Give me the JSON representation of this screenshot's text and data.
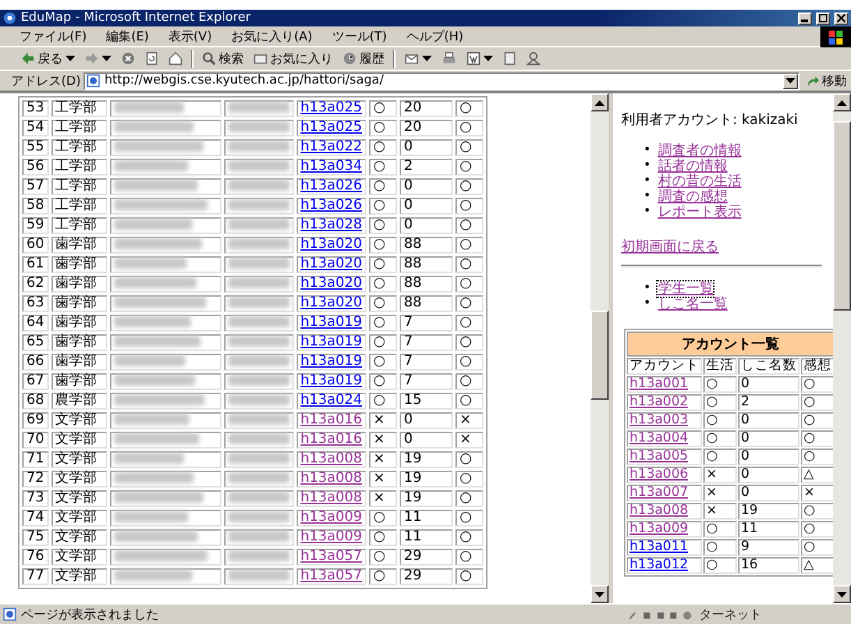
{
  "window": {
    "title": "EduMap - Microsoft Internet Explorer"
  },
  "menu": [
    "ファイル(F)",
    "編集(E)",
    "表示(V)",
    "お気に入り(A)",
    "ツール(T)",
    "ヘルプ(H)"
  ],
  "toolbar": [
    {
      "kind": "back",
      "label": "戻る"
    },
    {
      "kind": "forward"
    },
    {
      "kind": "stop"
    },
    {
      "kind": "refresh"
    },
    {
      "kind": "home"
    },
    {
      "kind": "search",
      "label": "検索"
    },
    {
      "kind": "favorites",
      "label": "お気に入り"
    },
    {
      "kind": "history",
      "label": "履歴"
    },
    {
      "kind": "mail"
    },
    {
      "kind": "print"
    },
    {
      "kind": "edit"
    },
    {
      "kind": "discuss"
    },
    {
      "kind": "messenger"
    }
  ],
  "address": {
    "label": "アドレス(D)",
    "value": "http://webgis.cse.kyutech.ac.jp/hattori/saga/",
    "go": "移動"
  },
  "student_rows": [
    {
      "no": "53",
      "faculty": "工学部",
      "account": "h13a025",
      "visited": false,
      "life": "○",
      "count": "20",
      "impression": "○"
    },
    {
      "no": "54",
      "faculty": "工学部",
      "account": "h13a025",
      "visited": false,
      "life": "○",
      "count": "20",
      "impression": "○"
    },
    {
      "no": "55",
      "faculty": "工学部",
      "account": "h13a022",
      "visited": false,
      "life": "○",
      "count": "0",
      "impression": "○"
    },
    {
      "no": "56",
      "faculty": "工学部",
      "account": "h13a034",
      "visited": false,
      "life": "○",
      "count": "2",
      "impression": "○"
    },
    {
      "no": "57",
      "faculty": "工学部",
      "account": "h13a026",
      "visited": false,
      "life": "○",
      "count": "0",
      "impression": "○"
    },
    {
      "no": "58",
      "faculty": "工学部",
      "account": "h13a026",
      "visited": false,
      "life": "○",
      "count": "0",
      "impression": "○"
    },
    {
      "no": "59",
      "faculty": "工学部",
      "account": "h13a028",
      "visited": false,
      "life": "○",
      "count": "0",
      "impression": "○"
    },
    {
      "no": "60",
      "faculty": "歯学部",
      "account": "h13a020",
      "visited": false,
      "life": "○",
      "count": "88",
      "impression": "○"
    },
    {
      "no": "61",
      "faculty": "歯学部",
      "account": "h13a020",
      "visited": false,
      "life": "○",
      "count": "88",
      "impression": "○"
    },
    {
      "no": "62",
      "faculty": "歯学部",
      "account": "h13a020",
      "visited": false,
      "life": "○",
      "count": "88",
      "impression": "○"
    },
    {
      "no": "63",
      "faculty": "歯学部",
      "account": "h13a020",
      "visited": false,
      "life": "○",
      "count": "88",
      "impression": "○"
    },
    {
      "no": "64",
      "faculty": "歯学部",
      "account": "h13a019",
      "visited": false,
      "life": "○",
      "count": "7",
      "impression": "○"
    },
    {
      "no": "65",
      "faculty": "歯学部",
      "account": "h13a019",
      "visited": false,
      "life": "○",
      "count": "7",
      "impression": "○"
    },
    {
      "no": "66",
      "faculty": "歯学部",
      "account": "h13a019",
      "visited": false,
      "life": "○",
      "count": "7",
      "impression": "○"
    },
    {
      "no": "67",
      "faculty": "歯学部",
      "account": "h13a019",
      "visited": false,
      "life": "○",
      "count": "7",
      "impression": "○"
    },
    {
      "no": "68",
      "faculty": "農学部",
      "account": "h13a024",
      "visited": false,
      "life": "○",
      "count": "15",
      "impression": "○"
    },
    {
      "no": "69",
      "faculty": "文学部",
      "account": "h13a016",
      "visited": true,
      "life": "×",
      "count": "0",
      "impression": "×"
    },
    {
      "no": "70",
      "faculty": "文学部",
      "account": "h13a016",
      "visited": true,
      "life": "×",
      "count": "0",
      "impression": "×"
    },
    {
      "no": "71",
      "faculty": "文学部",
      "account": "h13a008",
      "visited": true,
      "life": "×",
      "count": "19",
      "impression": "○"
    },
    {
      "no": "72",
      "faculty": "文学部",
      "account": "h13a008",
      "visited": true,
      "life": "×",
      "count": "19",
      "impression": "○"
    },
    {
      "no": "73",
      "faculty": "文学部",
      "account": "h13a008",
      "visited": true,
      "life": "×",
      "count": "19",
      "impression": "○"
    },
    {
      "no": "74",
      "faculty": "文学部",
      "account": "h13a009",
      "visited": true,
      "life": "○",
      "count": "11",
      "impression": "○"
    },
    {
      "no": "75",
      "faculty": "文学部",
      "account": "h13a009",
      "visited": true,
      "life": "○",
      "count": "11",
      "impression": "○"
    },
    {
      "no": "76",
      "faculty": "文学部",
      "account": "h13a057",
      "visited": true,
      "life": "○",
      "count": "29",
      "impression": "○"
    },
    {
      "no": "77",
      "faculty": "文学部",
      "account": "h13a057",
      "visited": true,
      "life": "○",
      "count": "29",
      "impression": "○"
    }
  ],
  "side": {
    "user": "利用者アカウント: kakizaki",
    "menu_links": [
      {
        "marker": "•",
        "label": "調査者の情報",
        "visited": true
      },
      {
        "marker": "•",
        "label": "話者の情報",
        "visited": true
      },
      {
        "marker": "•",
        "label": "村の昔の生活",
        "visited": true
      },
      {
        "marker": "•",
        "label": "調査の感想",
        "visited": true
      },
      {
        "marker": "•",
        "label": "レポート表示",
        "visited": true
      }
    ],
    "back_link": {
      "label": "初期画面に戻る",
      "visited": true
    },
    "list_links": [
      {
        "marker": "•",
        "label": "学生一覧",
        "visited": true,
        "focused": true
      },
      {
        "marker": "•",
        "label": "しこ名一覧",
        "visited": true,
        "focused": false
      }
    ],
    "account_table": {
      "title": "アカウント一覧",
      "columns": [
        "アカウント",
        "生活",
        "しこ名数",
        "感想"
      ],
      "rows": [
        {
          "account": "h13a001",
          "visited": true,
          "life": "○",
          "count": "0",
          "impression": "○"
        },
        {
          "account": "h13a002",
          "visited": true,
          "life": "○",
          "count": "2",
          "impression": "○"
        },
        {
          "account": "h13a003",
          "visited": true,
          "life": "○",
          "count": "0",
          "impression": "○"
        },
        {
          "account": "h13a004",
          "visited": true,
          "life": "○",
          "count": "0",
          "impression": "○"
        },
        {
          "account": "h13a005",
          "visited": true,
          "life": "○",
          "count": "0",
          "impression": "○"
        },
        {
          "account": "h13a006",
          "visited": true,
          "life": "×",
          "count": "0",
          "impression": "△"
        },
        {
          "account": "h13a007",
          "visited": true,
          "life": "×",
          "count": "0",
          "impression": "×"
        },
        {
          "account": "h13a008",
          "visited": true,
          "life": "×",
          "count": "19",
          "impression": "○"
        },
        {
          "account": "h13a009",
          "visited": true,
          "life": "○",
          "count": "11",
          "impression": "○"
        },
        {
          "account": "h13a011",
          "visited": false,
          "life": "○",
          "count": "9",
          "impression": "○"
        },
        {
          "account": "h13a012",
          "visited": false,
          "life": "○",
          "count": "16",
          "impression": "△"
        }
      ]
    }
  },
  "status_bar": {
    "text": "ページが表示されました",
    "zone": "ターネット"
  }
}
